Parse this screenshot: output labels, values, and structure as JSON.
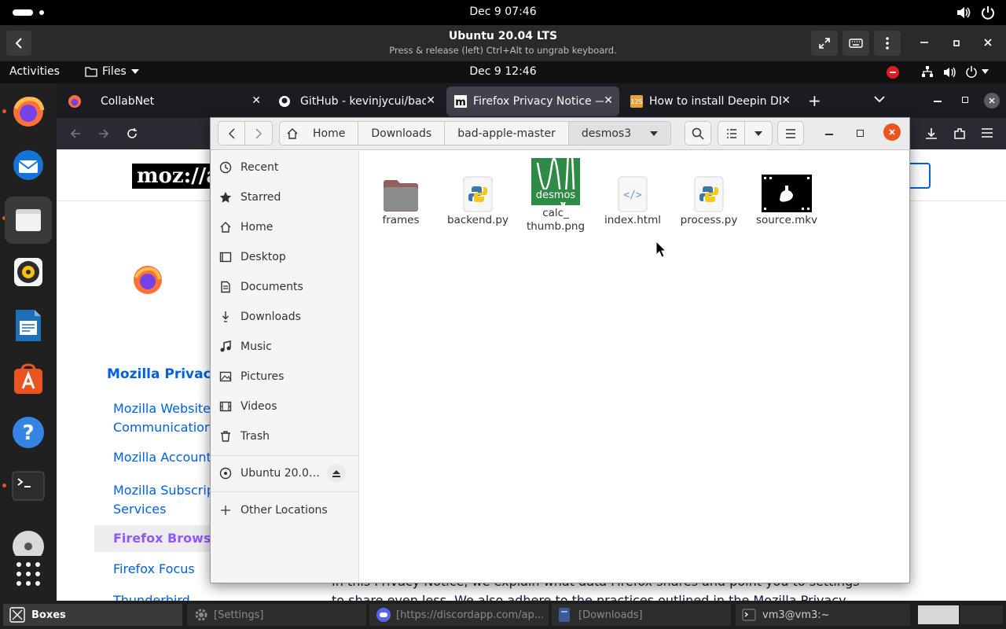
{
  "host": {
    "clock": "Dec 9  07:46"
  },
  "vm": {
    "title": "Ubuntu 20.04 LTS",
    "subtitle": "Press & release (left) Ctrl+Alt to ungrab keyboard."
  },
  "gnome": {
    "activities": "Activities",
    "app_menu": "Files",
    "clock": "Dec 9  12:46"
  },
  "firefox": {
    "tabs": [
      {
        "label": "CollabNet",
        "active": false
      },
      {
        "label": "GitHub - kevinjycui/bad-a",
        "active": false
      },
      {
        "label": "Firefox Privacy Notice —",
        "active": true
      },
      {
        "label": "How to install Deepin DD",
        "active": false
      }
    ],
    "page": {
      "logo": "moz://a",
      "sidebar_heading": "Mozilla Privacy",
      "sidebar_links": [
        {
          "label": "Mozilla Websites Communications",
          "lines": [
            "Mozilla Websites",
            "Communications"
          ]
        },
        {
          "label": "Mozilla Accounts"
        },
        {
          "label": "Mozilla Subscription Services",
          "lines": [
            "Mozilla Subscrip",
            "Services"
          ]
        },
        {
          "label": "Firefox Browser",
          "active": true
        },
        {
          "label": "Firefox Focus"
        },
        {
          "label": "Thunderbird"
        }
      ],
      "body_line1": "In this Privacy Notice, we explain what data Firefox shares and point you to settings",
      "body_line2": "to share even less. We also adhere to the practices outlined in the Mozilla Privacy"
    }
  },
  "files": {
    "breadcrumbs": [
      "Home",
      "Downloads",
      "bad-apple-master",
      "desmos3"
    ],
    "sidebar": [
      {
        "label": "Recent",
        "icon": "clock-icon"
      },
      {
        "label": "Starred",
        "icon": "star-icon"
      },
      {
        "label": "Home",
        "icon": "home-icon"
      },
      {
        "label": "Desktop",
        "icon": "desktop-icon"
      },
      {
        "label": "Documents",
        "icon": "document-icon"
      },
      {
        "label": "Downloads",
        "icon": "download-icon"
      },
      {
        "label": "Music",
        "icon": "music-icon"
      },
      {
        "label": "Pictures",
        "icon": "picture-icon"
      },
      {
        "label": "Videos",
        "icon": "video-icon"
      },
      {
        "label": "Trash",
        "icon": "trash-icon"
      }
    ],
    "drive": "Ubuntu 20.0…",
    "other_locations": "Other Locations",
    "items": [
      {
        "name": "frames",
        "type": "folder"
      },
      {
        "name": "backend.py",
        "type": "python"
      },
      {
        "name": "calc_\nthumb.png",
        "line1": "calc_",
        "line2": "thumb.png",
        "type": "image"
      },
      {
        "name": "index.html",
        "type": "html"
      },
      {
        "name": "process.py",
        "type": "python"
      },
      {
        "name": "source.mkv",
        "type": "video"
      }
    ],
    "thumb_text": "desmos"
  },
  "taskbar": {
    "items": [
      {
        "label": "Boxes"
      },
      {
        "label": "[Settings]"
      },
      {
        "label": "[https://discordapp.com/ap..."
      },
      {
        "label": "[Downloads]"
      },
      {
        "label": "vm3@vm3:~"
      }
    ]
  }
}
